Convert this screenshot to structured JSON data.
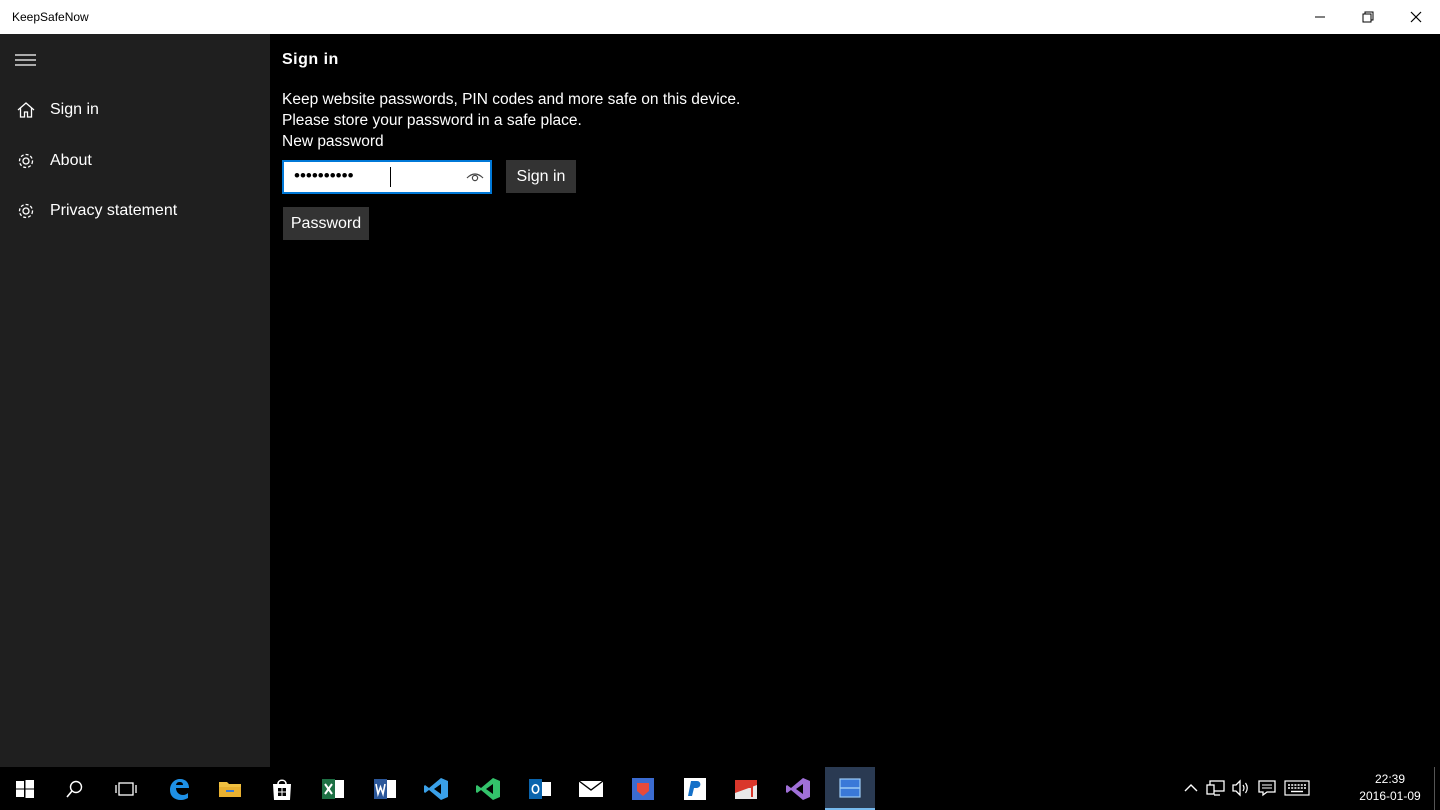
{
  "window": {
    "title": "KeepSafeNow",
    "controls": [
      "minimize-icon",
      "restore-icon",
      "close-icon"
    ]
  },
  "sidebar": {
    "menu_icon": "hamburger-icon",
    "items": [
      {
        "label": "Sign in",
        "icon": "home-icon"
      },
      {
        "label": "About",
        "icon": "gear-icon"
      },
      {
        "label": "Privacy statement",
        "icon": "gear-icon"
      }
    ]
  },
  "main": {
    "heading": "Sign in",
    "description_line1": "Keep website passwords, PIN codes and more safe on this device.",
    "description_line2": "Please store your password in a safe place.",
    "field_label": "New password",
    "password_value": "••••••••••",
    "reveal_icon": "eye-icon",
    "sign_in_button": "Sign in",
    "password_button": "Password"
  },
  "taskbar": {
    "apps": [
      "windows-start-icon",
      "search-icon",
      "task-view-icon",
      "edge-icon",
      "file-explorer-icon",
      "store-icon",
      "excel-icon",
      "word-icon",
      "vscode-icon",
      "visual-studio-green-icon",
      "outlook-icon",
      "mail-icon",
      "app-red-icon",
      "app-blue-icon",
      "app-pdf-icon",
      "visual-studio-icon",
      "keepsafenow-icon"
    ],
    "clock_time": "22:39",
    "clock_date": "2016-01-09"
  },
  "colors": {
    "accent": "#0078d7",
    "sidebar_bg": "#1f1f1f",
    "button_bg": "#333333"
  }
}
